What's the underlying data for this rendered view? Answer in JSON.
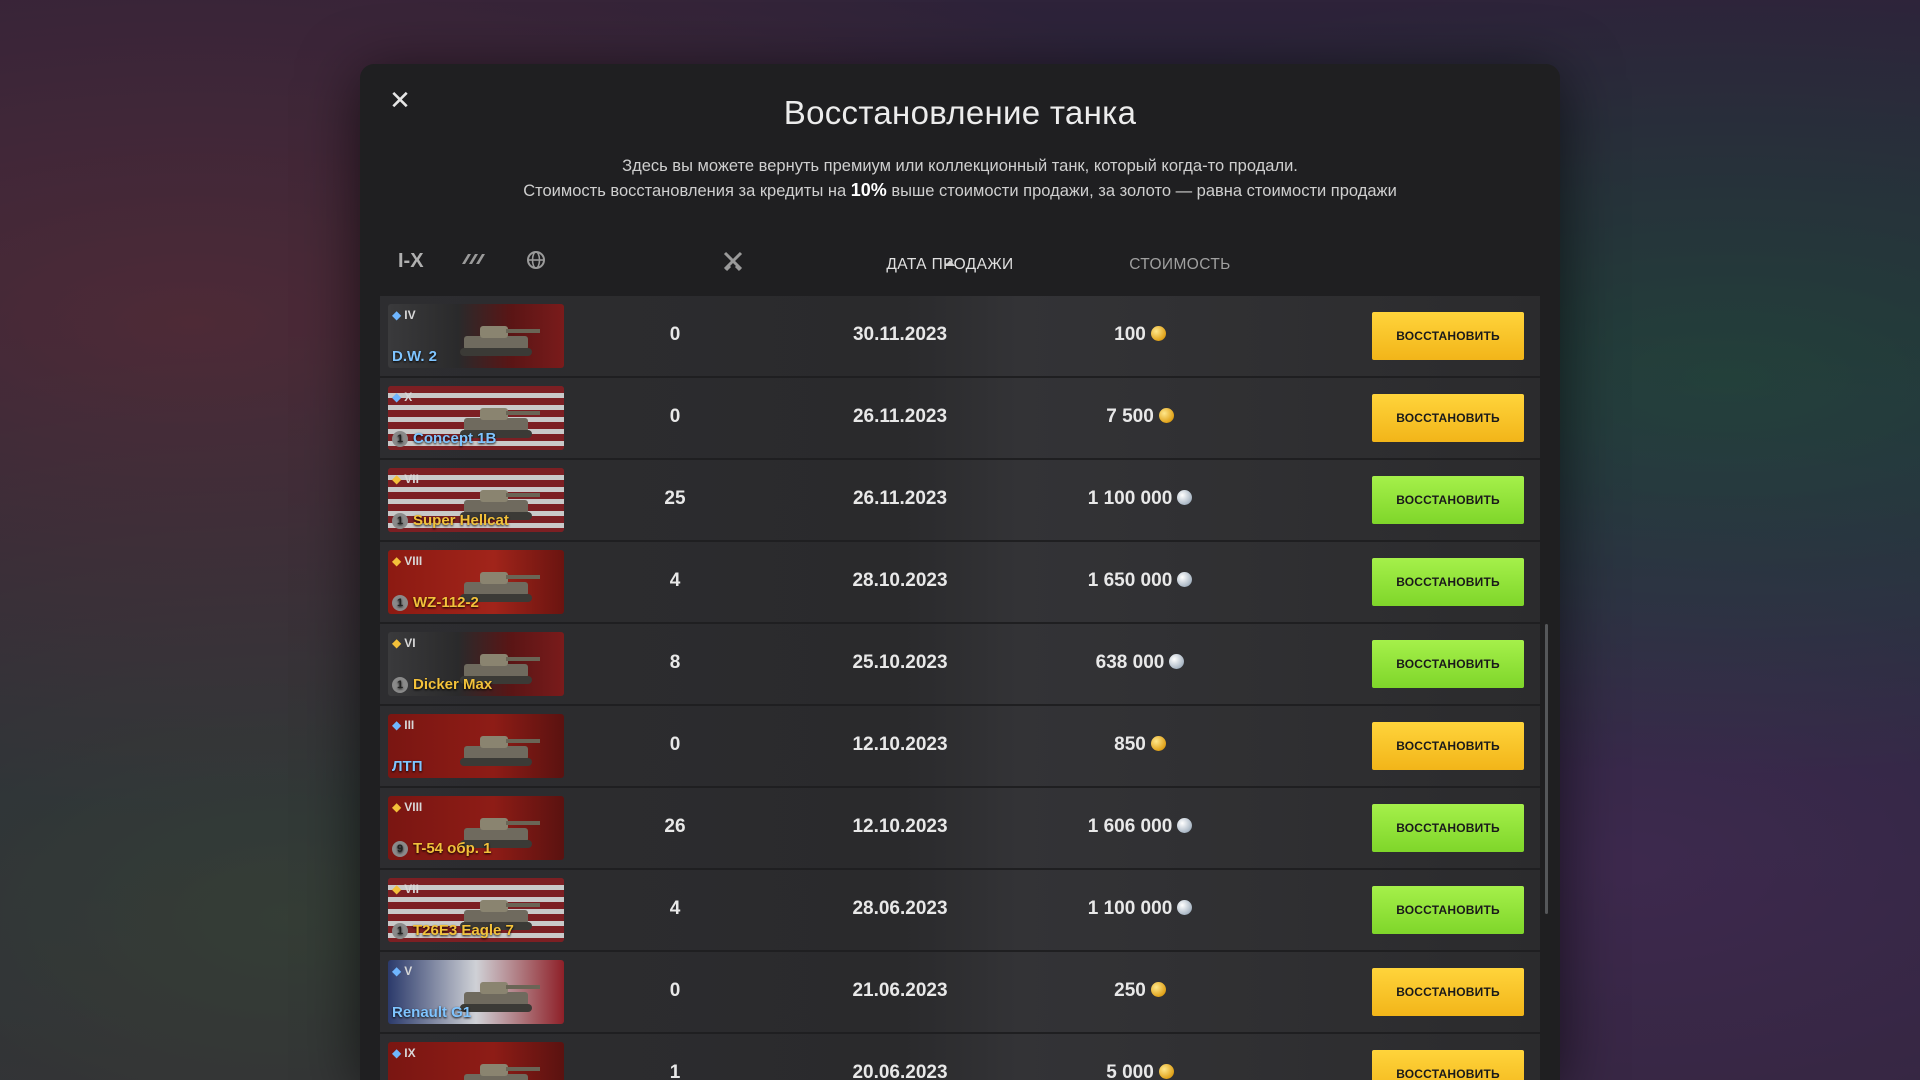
{
  "modal": {
    "close_label": "✕",
    "title": "Восстановление танка",
    "desc_line1": "Здесь вы можете вернуть премиум или коллекционный танк, который когда-то продали.",
    "desc_line2_pre": "Стоимость восстановления за кредиты на ",
    "desc_line2_bold": "10%",
    "desc_line2_post": " выше стоимости продажи, за золото — равна стоимости продажи"
  },
  "header": {
    "tier_filter": "I-X",
    "class_filter_icon": "tank-class-icon",
    "nation_filter_icon": "globe-icon",
    "battles_icon": "crossed-swords-icon",
    "date_label": "ДАТА ПРОДАЖИ",
    "cost_label": "СТОИМОСТЬ"
  },
  "colors": {
    "gold_button": "#f2b519",
    "green_button": "#8fe33a",
    "background": "#1f1f21"
  },
  "rows": [
    {
      "tier": "IV",
      "name": "D.W. 2",
      "nation": "germany",
      "premium": false,
      "mastery": "",
      "battles": "0",
      "date": "30.11.2023",
      "cost": "100",
      "currency": "gold",
      "button": "ВОССТАНОВИТЬ",
      "btn_color": "gold"
    },
    {
      "tier": "X",
      "name": "Concept 1B",
      "nation": "usa",
      "premium": false,
      "mastery": "1",
      "battles": "0",
      "date": "26.11.2023",
      "cost": "7 500",
      "currency": "gold",
      "button": "ВОССТАНОВИТЬ",
      "btn_color": "gold"
    },
    {
      "tier": "VII",
      "name": "Super Hellcat",
      "nation": "usa",
      "premium": true,
      "mastery": "1",
      "battles": "25",
      "date": "26.11.2023",
      "cost": "1 100 000",
      "currency": "silver",
      "button": "ВОССТАНОВИТЬ",
      "btn_color": "green"
    },
    {
      "tier": "VIII",
      "name": "WZ-112-2",
      "nation": "china",
      "premium": true,
      "mastery": "1",
      "battles": "4",
      "date": "28.10.2023",
      "cost": "1 650 000",
      "currency": "silver",
      "button": "ВОССТАНОВИТЬ",
      "btn_color": "green"
    },
    {
      "tier": "VI",
      "name": "Dicker Max",
      "nation": "germany",
      "premium": true,
      "mastery": "1",
      "battles": "8",
      "date": "25.10.2023",
      "cost": "638 000",
      "currency": "silver",
      "button": "ВОССТАНОВИТЬ",
      "btn_color": "green"
    },
    {
      "tier": "III",
      "name": "ЛТП",
      "nation": "ussr",
      "premium": false,
      "mastery": "",
      "battles": "0",
      "date": "12.10.2023",
      "cost": "850",
      "currency": "gold",
      "button": "ВОССТАНОВИТЬ",
      "btn_color": "gold"
    },
    {
      "tier": "VIII",
      "name": "T-54 обр. 1",
      "nation": "ussr",
      "premium": true,
      "mastery": "9",
      "battles": "26",
      "date": "12.10.2023",
      "cost": "1 606 000",
      "currency": "silver",
      "button": "ВОССТАНОВИТЬ",
      "btn_color": "green"
    },
    {
      "tier": "VII",
      "name": "T26E3 Eagle 7",
      "nation": "usa",
      "premium": true,
      "mastery": "1",
      "battles": "4",
      "date": "28.06.2023",
      "cost": "1 100 000",
      "currency": "silver",
      "button": "ВОССТАНОВИТЬ",
      "btn_color": "green"
    },
    {
      "tier": "V",
      "name": "Renault G1",
      "nation": "france",
      "premium": false,
      "mastery": "",
      "battles": "0",
      "date": "21.06.2023",
      "cost": "250",
      "currency": "gold",
      "button": "ВОССТАНОВИТЬ",
      "btn_color": "gold"
    },
    {
      "tier": "IX",
      "name": "",
      "nation": "ussr",
      "premium": false,
      "mastery": "",
      "battles": "1",
      "date": "20.06.2023",
      "cost": "5 000",
      "currency": "gold",
      "button": "ВОССТАНОВИТЬ",
      "btn_color": "gold"
    }
  ]
}
